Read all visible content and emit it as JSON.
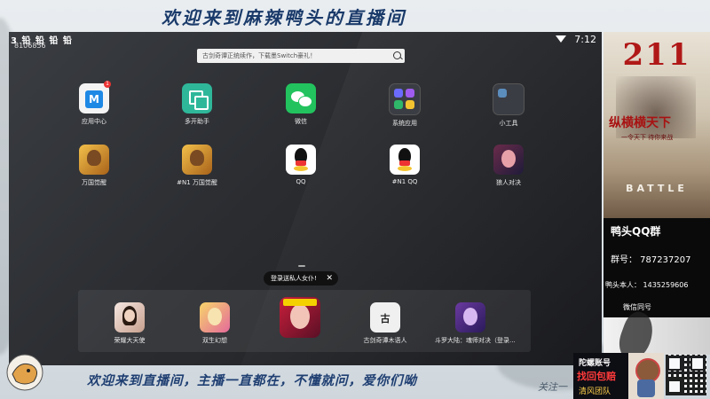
{
  "overlay": {
    "top_banner": "欢迎来到麻辣鸭头的直播间",
    "bottom_banner": "欢迎来到直播间，主播一直都在，不懂就问，爱你们呦",
    "follow_text": "关注一"
  },
  "status_bar": {
    "left": "3 铅 铅 铅 铅",
    "device_id": "8106856",
    "time": "7:12"
  },
  "search": {
    "placeholder": "古剑奇谭正统续作，下载墨Switch豪礼！"
  },
  "apps_row1": [
    {
      "label": "应用中心",
      "icon": "app-store-icon",
      "badge": "1"
    },
    {
      "label": "多开助手",
      "icon": "multi-open-icon"
    },
    {
      "label": "微信",
      "icon": "wechat-icon"
    },
    {
      "label": "系统应用",
      "icon": "system-apps-folder-icon"
    },
    {
      "label": "小工具",
      "icon": "tools-folder-icon"
    }
  ],
  "apps_row2": [
    {
      "label": "万国觉醒",
      "icon": "rise-of-kingdoms-icon"
    },
    {
      "label": "#N1 万国觉醒",
      "icon": "rise-of-kingdoms-clone-icon"
    },
    {
      "label": "QQ",
      "icon": "qq-icon"
    },
    {
      "label": "#N1 QQ",
      "icon": "qq-clone-icon"
    },
    {
      "label": "狼人对决",
      "icon": "werewolf-icon"
    }
  ],
  "tooltip": {
    "text": "登录送私人女仆!",
    "close": "✕"
  },
  "dock": [
    {
      "label": "荣耀大天使",
      "icon": "archangel-game-icon"
    },
    {
      "label": "双生幻想",
      "icon": "twin-fantasy-icon"
    },
    {
      "label": "",
      "icon": "featured-game-icon"
    },
    {
      "label": "古剑奇谭木语人",
      "icon": "gujian-game-icon"
    },
    {
      "label": "斗罗大陆：魂师对决（登录...",
      "icon": "douluo-game-icon"
    }
  ],
  "right_panel": {
    "poster_number": "211",
    "poster_title": "纵横横天下",
    "poster_subtitle": "一令天下  待你来战",
    "poster_battle": "BATTLE",
    "qq_group_title": "鸭头QQ群",
    "qq_group_number": "群号： 787237207",
    "owner": "鸭头本人： 1435259606",
    "wechat": "微信同号"
  },
  "promo": {
    "line1": "陀螺账号",
    "line2": "找回包赔",
    "line3": "清风团队"
  }
}
